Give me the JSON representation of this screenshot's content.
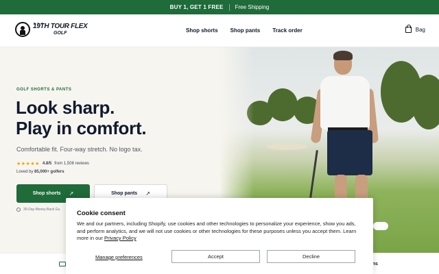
{
  "announcement": {
    "offer": "BUY 1, GET 1 FREE",
    "shipping": "Free Shipping",
    "background": "#1f6b3a"
  },
  "header": {
    "logo": {
      "line1": "19TH TOUR FLEX",
      "line2": "GOLF",
      "stars": "★★★"
    },
    "nav": [
      "Shop shorts",
      "Shop pants",
      "Track order"
    ],
    "bag_label": "Bag",
    "bag_icon": "bag-icon"
  },
  "hero": {
    "eyebrow": "GOLF SHORTS & PANTS",
    "headline_line1": "Look sharp.",
    "headline_line2": "Play in comfort.",
    "subhead": "Comfortable fit. Four-way stretch. No logo tax.",
    "rating": {
      "stars": "★★★★★",
      "score": "4.8/5",
      "reviews": "from 1,508 reviews"
    },
    "loved": {
      "prefix": "Loved by",
      "count": "85,000+ golfers"
    },
    "primary_cta": "Shop shorts",
    "secondary_cta": "Shop pants",
    "cta_arrow": "↗",
    "guarantee": "30-Day Money-Back Gu",
    "accent": "#1f6b3a"
  },
  "features_strip": {
    "truck_icon": "truck-icon",
    "returns_fragment": "rns"
  },
  "cookie_banner": {
    "title": "Cookie consent",
    "body": "We and our partners, including Shopify, use cookies and other technologies to personalize your experience, show you ads, and perform analytics, and we will not use cookies or other technologies for these purposes unless you accept them. Learn more in our ",
    "privacy_link": "Privacy Policy",
    "manage": "Manage preferences",
    "accept": "Accept",
    "decline": "Decline"
  }
}
